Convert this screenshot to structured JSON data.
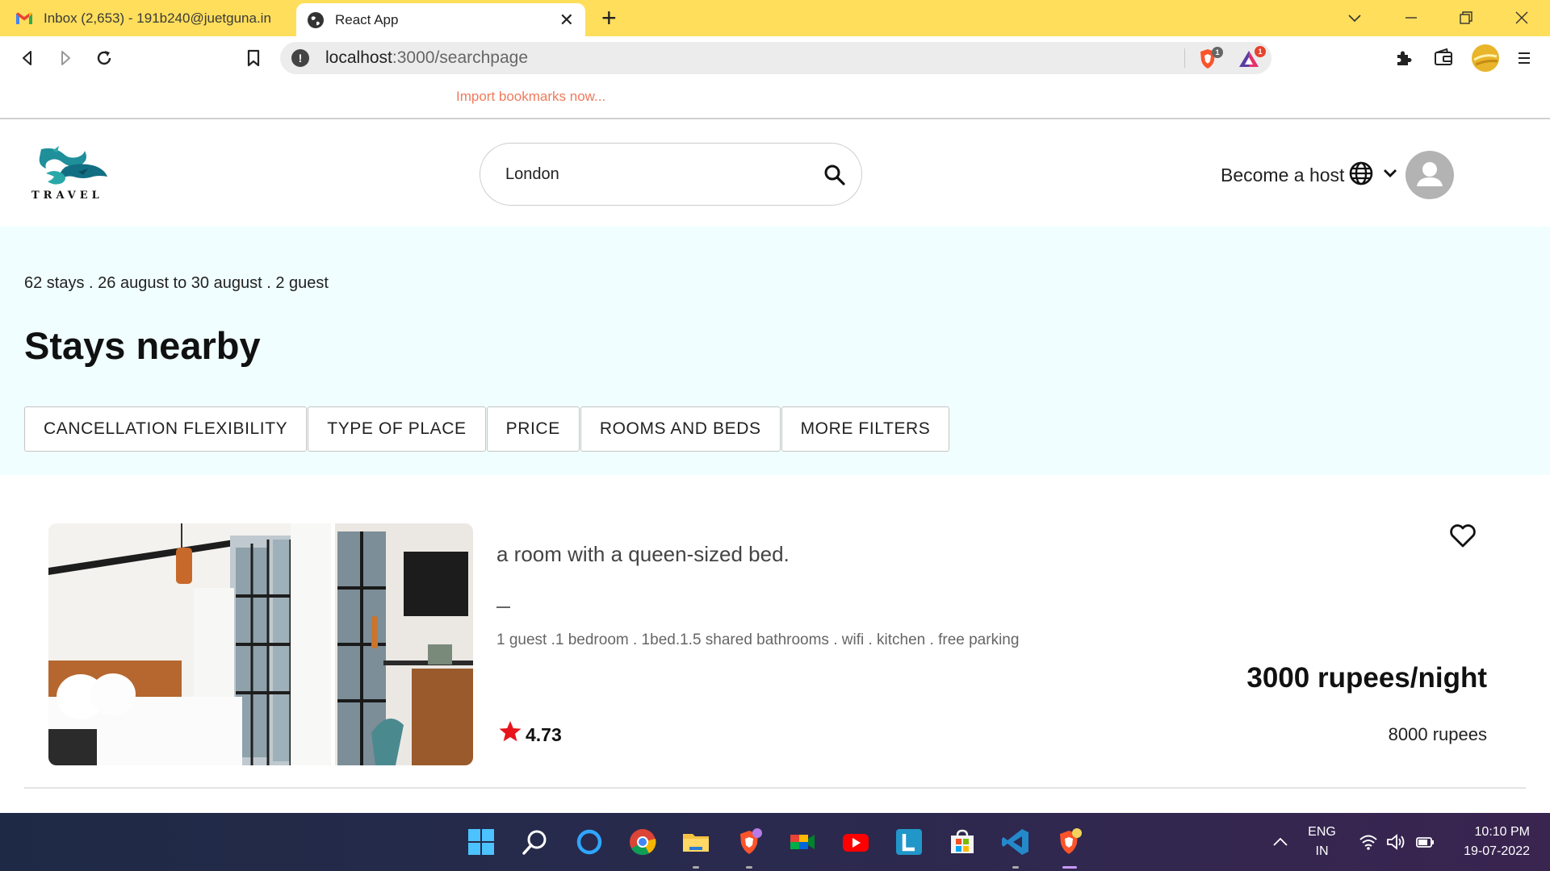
{
  "browser": {
    "tabs": [
      {
        "title": "Inbox (2,653) - 191b240@juetguna.in",
        "icon": "gmail-icon",
        "active": false
      },
      {
        "title": "React App",
        "icon": "globe-icon",
        "active": true
      }
    ],
    "tab_close": "✕",
    "new_tab": "+",
    "url_host": "localhost",
    "url_path": ":3000/searchpage",
    "brave_shield_badge": "1",
    "brave_rewards_badge": "1",
    "import_bookmarks": "Import bookmarks now..."
  },
  "app": {
    "logo_text": "TRAVEL",
    "search_value": "London",
    "become_host": "Become a host",
    "stays_info": "62 stays . 26 august to 30 august . 2 guest",
    "page_title": "Stays nearby",
    "filters": [
      "CANCELLATION FLEXIBILITY",
      "TYPE OF PLACE",
      "PRICE",
      "ROOMS AND BEDS",
      "MORE FILTERS"
    ],
    "listing": {
      "title": "a room with a queen-sized bed.",
      "description": "1 guest .1 bedroom . 1bed.1.5 shared bathrooms . wifi . kitchen . free parking",
      "rating": "4.73",
      "price_per_night": "3000 rupees/night",
      "total_price": "8000 rupees"
    }
  },
  "taskbar": {
    "icons": [
      "windows-start-icon",
      "search-icon",
      "cortana-icon",
      "chrome-icon",
      "file-explorer-icon",
      "brave-beta-icon",
      "google-meet-icon",
      "youtube-icon",
      "l-app-icon",
      "microsoft-store-icon",
      "vscode-icon",
      "brave-icon"
    ],
    "lang_top": "ENG",
    "lang_bottom": "IN",
    "time": "10:10 PM",
    "date": "19-07-2022"
  },
  "colors": {
    "tab_bar": "#fede5b",
    "hero_bg": "#f0feff",
    "accent_star": "#e8141b",
    "import_link": "#f07a5b"
  }
}
